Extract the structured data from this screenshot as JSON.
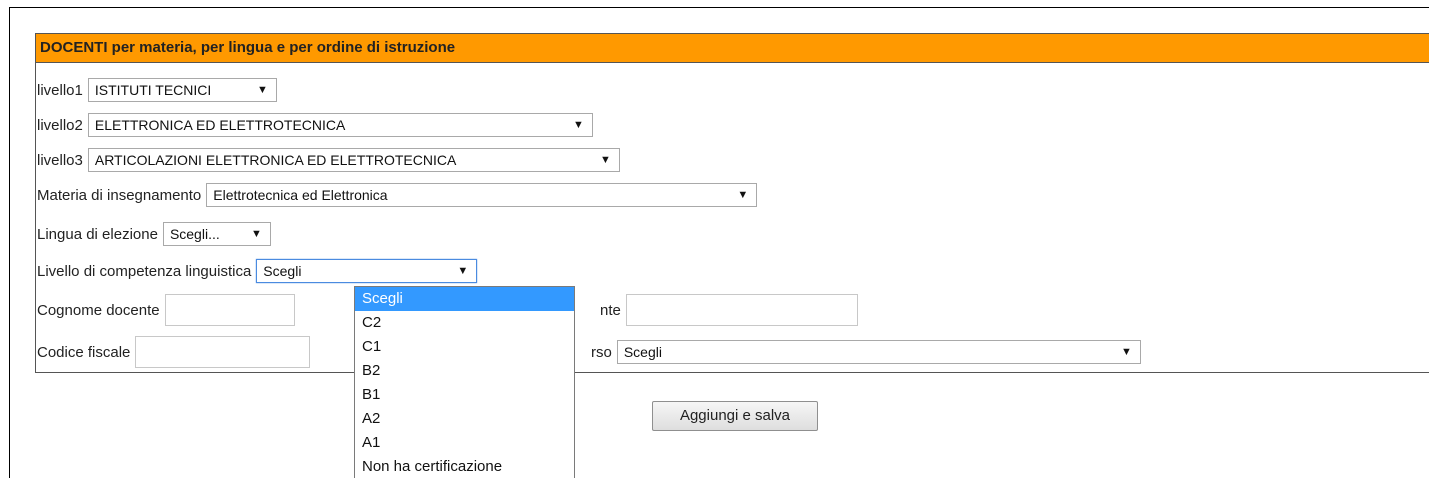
{
  "form": {
    "title": "DOCENTI per materia, per lingua e per ordine di istruzione",
    "livello1": {
      "label": "livello1",
      "value": "ISTITUTI TECNICI"
    },
    "livello2": {
      "label": "livello2",
      "value": "ELETTRONICA ED ELETTROTECNICA"
    },
    "livello3": {
      "label": "livello3",
      "value": "ARTICOLAZIONI ELETTRONICA ED ELETTROTECNICA"
    },
    "materia": {
      "label": "Materia di insegnamento",
      "value": "Elettrotecnica ed Elettronica"
    },
    "lingua": {
      "label": "Lingua di elezione",
      "value": "Scegli..."
    },
    "livello_competenza": {
      "label": "Livello di competenza linguistica",
      "value": "Scegli"
    },
    "cognome": {
      "label": "Cognome docente",
      "value": ""
    },
    "nome": {
      "label_visible_fragment": "nte",
      "value": ""
    },
    "codice_fiscale": {
      "label": "Codice fiscale",
      "value": ""
    },
    "corso": {
      "label_visible_fragment": "rso",
      "value": "Scegli"
    }
  },
  "dropdown": {
    "options": [
      "Scegli",
      "C2",
      "C1",
      "B2",
      "B1",
      "A2",
      "A1",
      "Non ha certificazione"
    ],
    "highlighted": "Scegli"
  },
  "actions": {
    "save_label": "Aggiungi e salva"
  },
  "icons": {
    "select_arrow": "dropdown-arrow-icon"
  },
  "colors": {
    "header_bg": "#ff9900",
    "highlight": "#3399ff"
  }
}
